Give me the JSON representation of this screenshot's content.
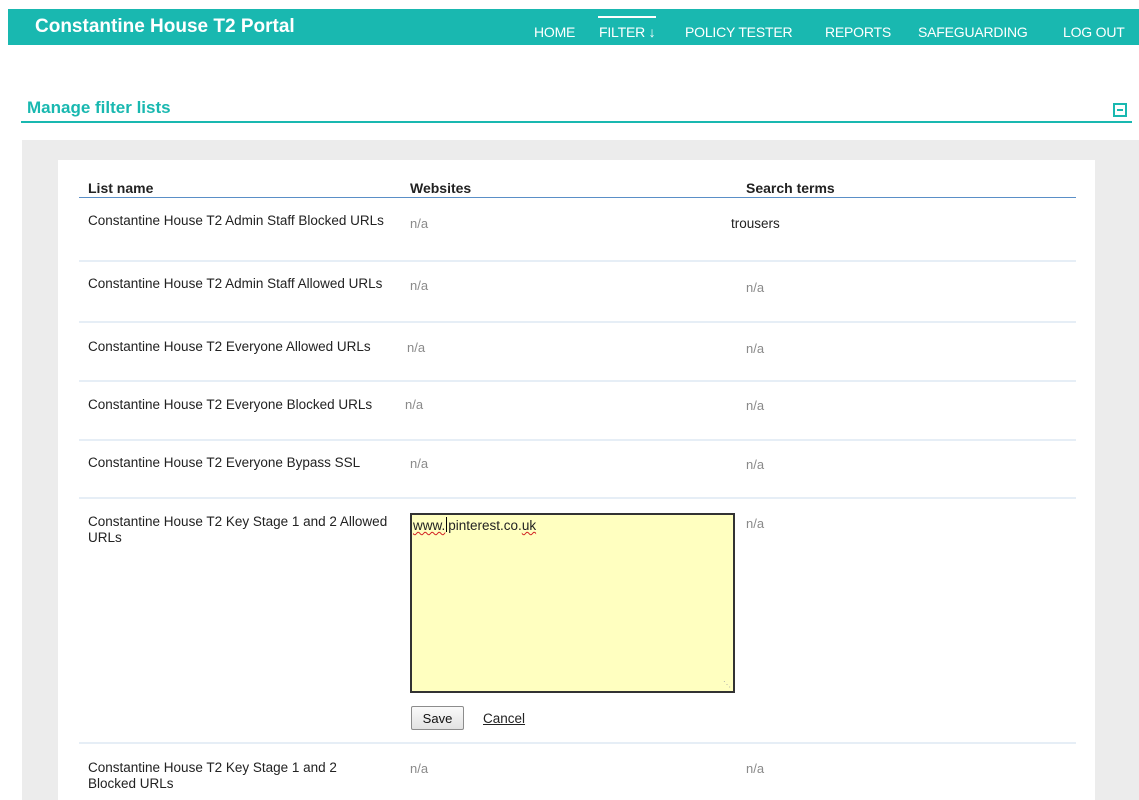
{
  "header": {
    "title": "Constantine House T2 Portal",
    "nav": [
      "HOME",
      "FILTER ↓",
      "POLICY TESTER",
      "REPORTS",
      "SAFEGUARDING",
      "LOG OUT"
    ],
    "active_nav": "FILTER ↓"
  },
  "section": {
    "title": "Manage filter lists",
    "collapse_icon": "minus-box-icon"
  },
  "table": {
    "columns": [
      "List name",
      "Websites",
      "Search terms"
    ],
    "rows": [
      {
        "name": "Constantine House T2 Admin Staff Blocked URLs",
        "websites": "n/a",
        "search_terms": "trousers"
      },
      {
        "name": "Constantine House T2 Admin Staff Allowed URLs",
        "websites": "n/a",
        "search_terms": "n/a"
      },
      {
        "name": "Constantine House T2 Everyone Allowed URLs",
        "websites": "n/a",
        "search_terms": "n/a"
      },
      {
        "name": "Constantine House T2 Everyone Blocked URLs",
        "websites": "n/a",
        "search_terms": "n/a"
      },
      {
        "name": "Constantine House T2 Everyone Bypass SSL",
        "websites": "n/a",
        "search_terms": "n/a"
      },
      {
        "name": "Constantine House T2 Key Stage 1 and 2 Allowed URLs",
        "websites": "www.pinterest.co.uk",
        "search_terms": "n/a"
      },
      {
        "name": "Constantine House T2 Key Stage 1 and 2 Blocked URLs",
        "websites": "n/a",
        "search_terms": "n/a"
      }
    ]
  },
  "editor": {
    "text_prefix": "www.",
    "text_mid": "pinterest.co.",
    "text_suffix": "uk",
    "save_label": "Save",
    "cancel_label": "Cancel"
  },
  "colors": {
    "brand": "#19b8b0",
    "editor_bg": "#ffffc0",
    "header_rule": "#5a8fc7"
  }
}
